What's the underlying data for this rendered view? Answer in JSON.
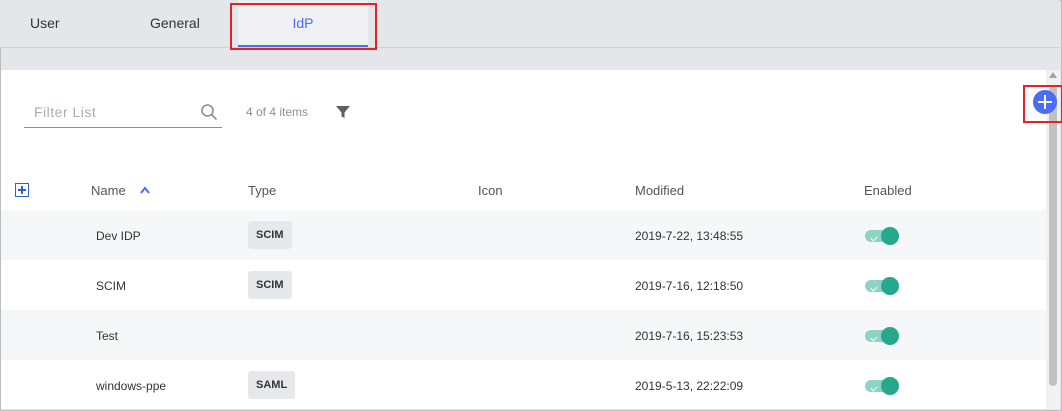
{
  "tabs": {
    "user": "User",
    "general": "General",
    "idp": "IdP"
  },
  "toolbar": {
    "filter_placeholder": "Filter List",
    "count": "4 of 4 items",
    "search_icon": "search-icon",
    "filter_icon": "filter-icon",
    "add_icon": "plus-circle-icon"
  },
  "table": {
    "headers": {
      "name": "Name",
      "type": "Type",
      "icon": "Icon",
      "modified": "Modified",
      "enabled": "Enabled"
    },
    "rows": [
      {
        "name": "Dev IDP",
        "type": "SCIM",
        "modified": "2019-7-22, 13:48:55",
        "enabled": true
      },
      {
        "name": "SCIM",
        "type": "SCIM",
        "modified": "2019-7-16, 12:18:50",
        "enabled": true
      },
      {
        "name": "Test",
        "type": "",
        "modified": "2019-7-16, 15:23:53",
        "enabled": true
      },
      {
        "name": "windows-ppe",
        "type": "SAML",
        "modified": "2019-5-13, 22:22:09",
        "enabled": true
      }
    ]
  },
  "colors": {
    "accent": "#4a6cf7",
    "toggle_on": "#26a88f",
    "highlight": "#e1222b"
  }
}
